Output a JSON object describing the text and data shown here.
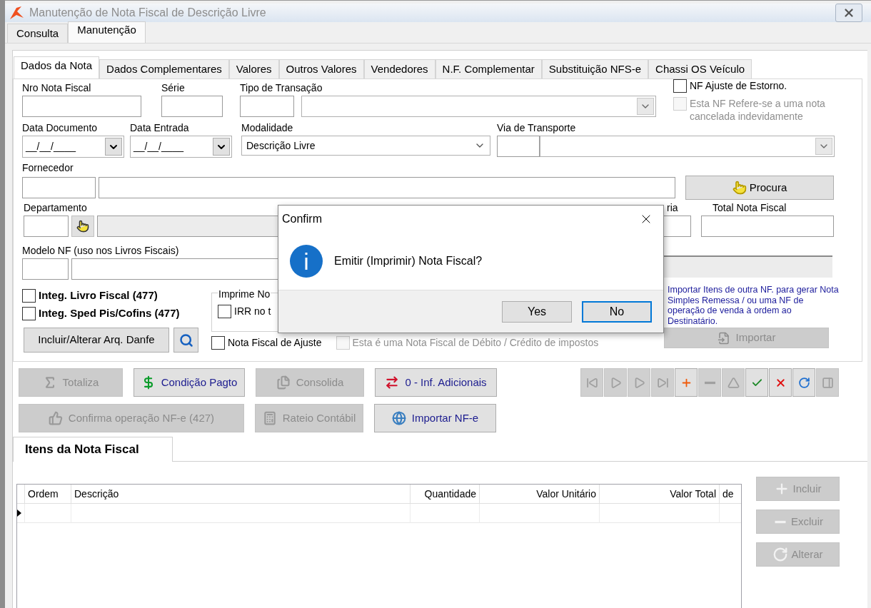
{
  "window": {
    "title": "Manutenção de Nota Fiscal de Descrição Livre"
  },
  "main_tabs": [
    {
      "label": "Consulta",
      "selected": false
    },
    {
      "label": "Manutenção",
      "selected": true
    }
  ],
  "sub_tabs": [
    {
      "label": "Dados da Nota",
      "selected": true
    },
    {
      "label": "Dados Complementares",
      "selected": false
    },
    {
      "label": "Valores",
      "selected": false
    },
    {
      "label": "Outros Valores",
      "selected": false
    },
    {
      "label": "Vendedores",
      "selected": false
    },
    {
      "label": "N.F. Complementar",
      "selected": false
    },
    {
      "label": "Substituição NFS-e",
      "selected": false
    },
    {
      "label": "Chassi OS Veículo",
      "selected": false
    }
  ],
  "form": {
    "nro_nota_fiscal": {
      "label": "Nro Nota Fiscal"
    },
    "serie": {
      "label": "Série"
    },
    "tipo_transacao": {
      "label": "Tipo de Transação"
    },
    "nf_ajuste_estorno": {
      "label": "NF Ajuste de Estorno.",
      "checked": false,
      "disabled": false
    },
    "nf_cancelada": {
      "label": "Esta NF Refere-se a uma nota cancelada indevidamente",
      "checked": false,
      "disabled": true
    },
    "data_documento": {
      "label": "Data Documento",
      "value": "__/__/____"
    },
    "data_entrada": {
      "label": "Data Entrada",
      "value": "__/__/____"
    },
    "modalidade": {
      "label": "Modalidade",
      "value": "Descrição Livre"
    },
    "via_transporte": {
      "label": "Via de Transporte"
    },
    "fornecedor": {
      "label": "Fornecedor"
    },
    "procura_button": {
      "label": "Procura"
    },
    "departamento": {
      "label": "Departamento"
    },
    "total_partial": {
      "label": "ria"
    },
    "total_nota_fiscal": {
      "label": "Total Nota Fiscal"
    },
    "modelo_nf": {
      "label": "Modelo NF (uso nos Livros Fiscais)"
    },
    "integ_checkboxes": [
      {
        "label": "Integ. Livro Fiscal (477)",
        "checked": false
      },
      {
        "label": "Integ. Sped Pis/Cofins (477)",
        "checked": false
      }
    ],
    "imprime_group": {
      "legend": "Imprime No",
      "checkbox": {
        "label": "IRR no t",
        "checked": false
      }
    },
    "danfe_button": {
      "label": "Incluir/Alterar Arq. Danfe"
    },
    "ajuste_checkboxes": [
      {
        "label": "Nota Fiscal de Ajuste",
        "checked": false,
        "disabled": false
      },
      {
        "label": "Esta é uma Nota Fiscal de Débito / Crédito de impostos",
        "checked": false,
        "disabled": true
      }
    ],
    "import_note": "Importar Itens de outra NF. para gerar Nota Simples Remessa / ou uma NF de operação de venda à ordem ao Destinatário.",
    "importar_button": {
      "label": "Importar",
      "disabled": true
    }
  },
  "action_rows": [
    {
      "buttons": [
        {
          "label": "Totaliza",
          "kind": "sigma",
          "disabled": true
        },
        {
          "label": "Condição Pagto",
          "kind": "dollar",
          "disabled": false
        },
        {
          "label": "Consolida",
          "kind": "files",
          "disabled": true
        },
        {
          "label": "0 - Inf. Adicionais",
          "kind": "arrows",
          "disabled": false
        }
      ]
    },
    {
      "buttons": [
        {
          "label": "Confirma operação NF-e (427)",
          "kind": "thumb",
          "disabled": true
        },
        {
          "label": "Rateio Contábil",
          "kind": "calculator",
          "disabled": true
        },
        {
          "label": "Importar NF-e",
          "kind": "globe",
          "disabled": false
        }
      ]
    }
  ],
  "nav_toolbar": [
    {
      "kind": "first",
      "disabled": true
    },
    {
      "kind": "prev",
      "disabled": true
    },
    {
      "kind": "next",
      "disabled": true
    },
    {
      "kind": "last",
      "disabled": true
    },
    {
      "kind": "plus",
      "disabled": false
    },
    {
      "kind": "minus",
      "disabled": true
    },
    {
      "kind": "up",
      "disabled": true
    },
    {
      "kind": "check",
      "disabled": false
    },
    {
      "kind": "cancel",
      "disabled": false
    },
    {
      "kind": "refresh",
      "disabled": false
    },
    {
      "kind": "panel",
      "disabled": true
    }
  ],
  "items_tab": {
    "label": "Itens da Nota Fiscal"
  },
  "table": {
    "columns": [
      {
        "label": "Ordem"
      },
      {
        "label": "Descrição"
      },
      {
        "label": "Quantidade"
      },
      {
        "label": "Valor Unitário"
      },
      {
        "label": "Valor Total"
      },
      {
        "label": "de"
      }
    ],
    "rows": [
      {
        "current": true
      }
    ]
  },
  "item_buttons": [
    {
      "label": "Incluir",
      "kind": "plus",
      "disabled": true
    },
    {
      "label": "Excluir",
      "kind": "minus",
      "disabled": true
    },
    {
      "label": "Alterar",
      "kind": "refresh",
      "disabled": true
    }
  ],
  "dialog": {
    "title": "Confirm",
    "message": "Emitir (Imprimir) Nota Fiscal?",
    "buttons": [
      {
        "label": "Yes",
        "focused": false
      },
      {
        "label": "No",
        "focused": true
      }
    ]
  }
}
